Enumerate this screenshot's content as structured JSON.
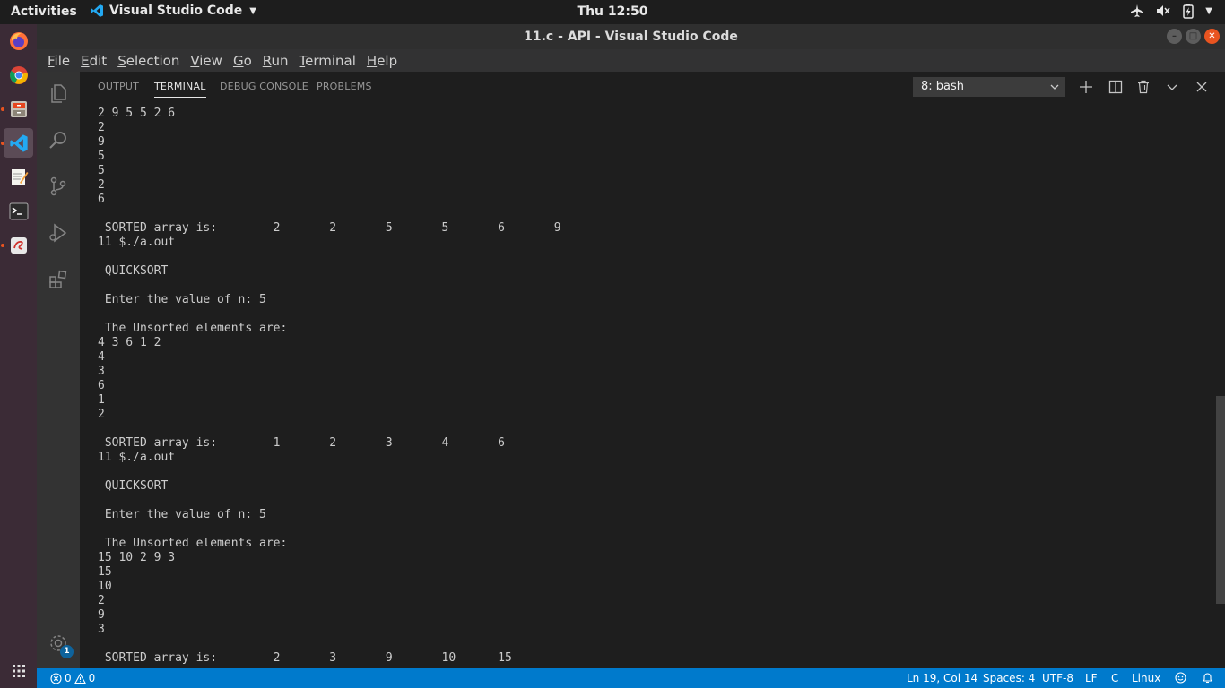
{
  "topbar": {
    "activities": "Activities",
    "app_name": "Visual Studio Code",
    "clock": "Thu 12:50"
  },
  "window": {
    "title": "11.c - API - Visual Studio Code"
  },
  "menubar": {
    "items": [
      {
        "key": "F",
        "rest": "ile"
      },
      {
        "key": "E",
        "rest": "dit"
      },
      {
        "key": "S",
        "rest": "election"
      },
      {
        "key": "V",
        "rest": "iew"
      },
      {
        "key": "G",
        "rest": "o"
      },
      {
        "key": "R",
        "rest": "un"
      },
      {
        "key": "T",
        "rest": "erminal"
      },
      {
        "key": "H",
        "rest": "elp"
      }
    ]
  },
  "activitybar": {
    "settings_badge": "1"
  },
  "panel": {
    "tabs": [
      "OUTPUT",
      "TERMINAL",
      "DEBUG CONSOLE",
      "PROBLEMS"
    ],
    "active_tab": "TERMINAL",
    "terminal_selected": "8: bash"
  },
  "terminal": {
    "lines": [
      "2 9 5 5 2 6",
      "2",
      "9",
      "5",
      "5",
      "2",
      "6",
      "",
      " SORTED array is:        2       2       5       5       6       9",
      "11 $./a.out",
      "",
      " QUICKSORT",
      "",
      " Enter the value of n: 5",
      "",
      " The Unsorted elements are:",
      "4 3 6 1 2",
      "4",
      "3",
      "6",
      "1",
      "2",
      "",
      " SORTED array is:        1       2       3       4       6",
      "11 $./a.out",
      "",
      " QUICKSORT",
      "",
      " Enter the value of n: 5",
      "",
      " The Unsorted elements are:",
      "15 10 2 9 3",
      "15",
      "10",
      "2",
      "9",
      "3",
      "",
      " SORTED array is:        2       3       9       10      15"
    ]
  },
  "statusbar": {
    "errors": "0",
    "warnings": "0",
    "position": "Ln 19, Col 14",
    "spaces": "Spaces: 4",
    "encoding": "UTF-8",
    "eol": "LF",
    "language": "C",
    "os": "Linux"
  },
  "colors": {
    "accent": "#007acc",
    "ubuntu_orange": "#e95420",
    "dock_bg": "#3b2b36",
    "vscode_blue": "#23a9f2"
  }
}
